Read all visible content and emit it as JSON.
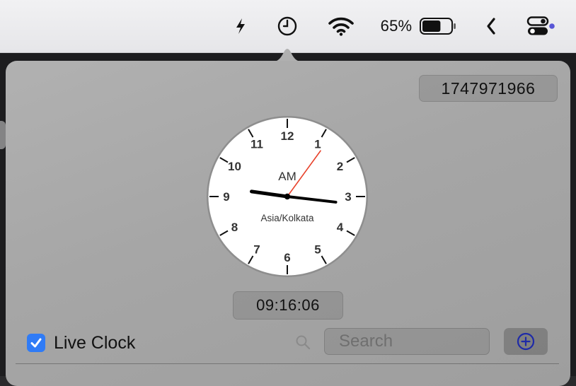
{
  "menubar": {
    "bolt_icon": "bolt-icon",
    "clock_icon": "clock-icon",
    "wifi_icon": "wifi-icon",
    "battery_percent": "65%",
    "battery_level": 0.65,
    "chevron_icon": "chevron-left-icon",
    "control_center_icon": "control-center-icon",
    "notification_dot_color": "#5856d6"
  },
  "popover": {
    "unix_timestamp": "1747971966",
    "clock": {
      "numerals": [
        "12",
        "1",
        "2",
        "3",
        "4",
        "5",
        "6",
        "7",
        "8",
        "9",
        "10",
        "11"
      ],
      "period": "AM",
      "timezone": "Asia/Kolkata",
      "hour": 9,
      "minute": 16,
      "second": 6,
      "second_hand_color": "#e8422b"
    },
    "time_display": "09:16:06",
    "live_clock": {
      "label": "Live Clock",
      "checked": true
    },
    "search": {
      "placeholder": "Search",
      "value": ""
    },
    "add_button_icon": "plus-circle-icon",
    "accent_color": "#2f7bf6"
  }
}
